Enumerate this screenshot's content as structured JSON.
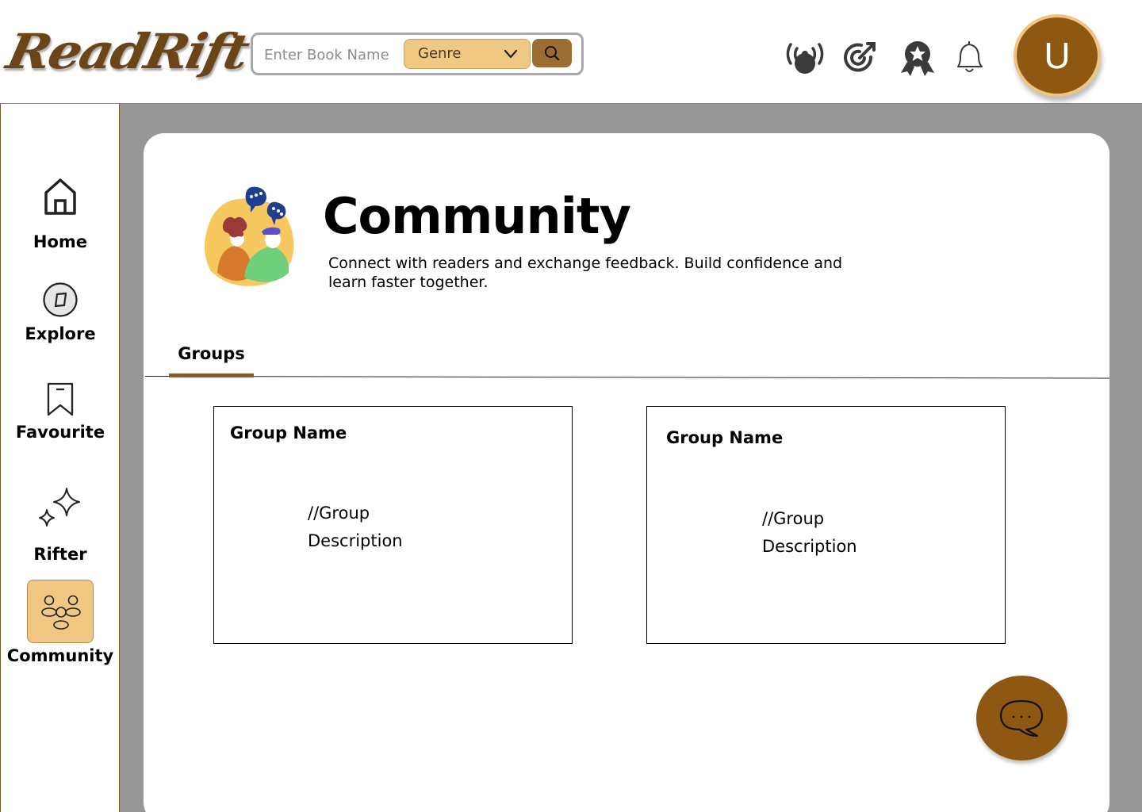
{
  "brand": {
    "logo_text": "ReadRift",
    "accent": "#8e5813",
    "accent_light": "#f0c884",
    "button": "#9c6d33"
  },
  "header": {
    "search": {
      "placeholder": "Enter Book Name",
      "value": ""
    },
    "genre": {
      "selected": "Genre"
    },
    "icons": [
      "broadcast-icon",
      "target-icon",
      "award-icon",
      "bell-icon"
    ],
    "avatar_initial": "U"
  },
  "sidebar": {
    "items": [
      {
        "label": "Home",
        "icon": "home-icon",
        "active": false
      },
      {
        "label": "Explore",
        "icon": "compass-icon",
        "active": false
      },
      {
        "label": "Favourite",
        "icon": "bookmark-icon",
        "active": false
      },
      {
        "label": "Rifter",
        "icon": "sparkle-icon",
        "active": false
      },
      {
        "label": "Community",
        "icon": "community-icon",
        "active": true
      }
    ]
  },
  "main": {
    "title": "Community",
    "subtitle": "Connect with readers and exchange feedback. Build confidence and learn faster together.",
    "tabs": [
      {
        "label": "Groups",
        "active": true
      }
    ],
    "groups": [
      {
        "name": "Group Name",
        "description": "//Group Description"
      },
      {
        "name": "Group Name",
        "description": "//Group Description"
      }
    ]
  },
  "chat_button": {
    "icon": "chat-icon"
  }
}
